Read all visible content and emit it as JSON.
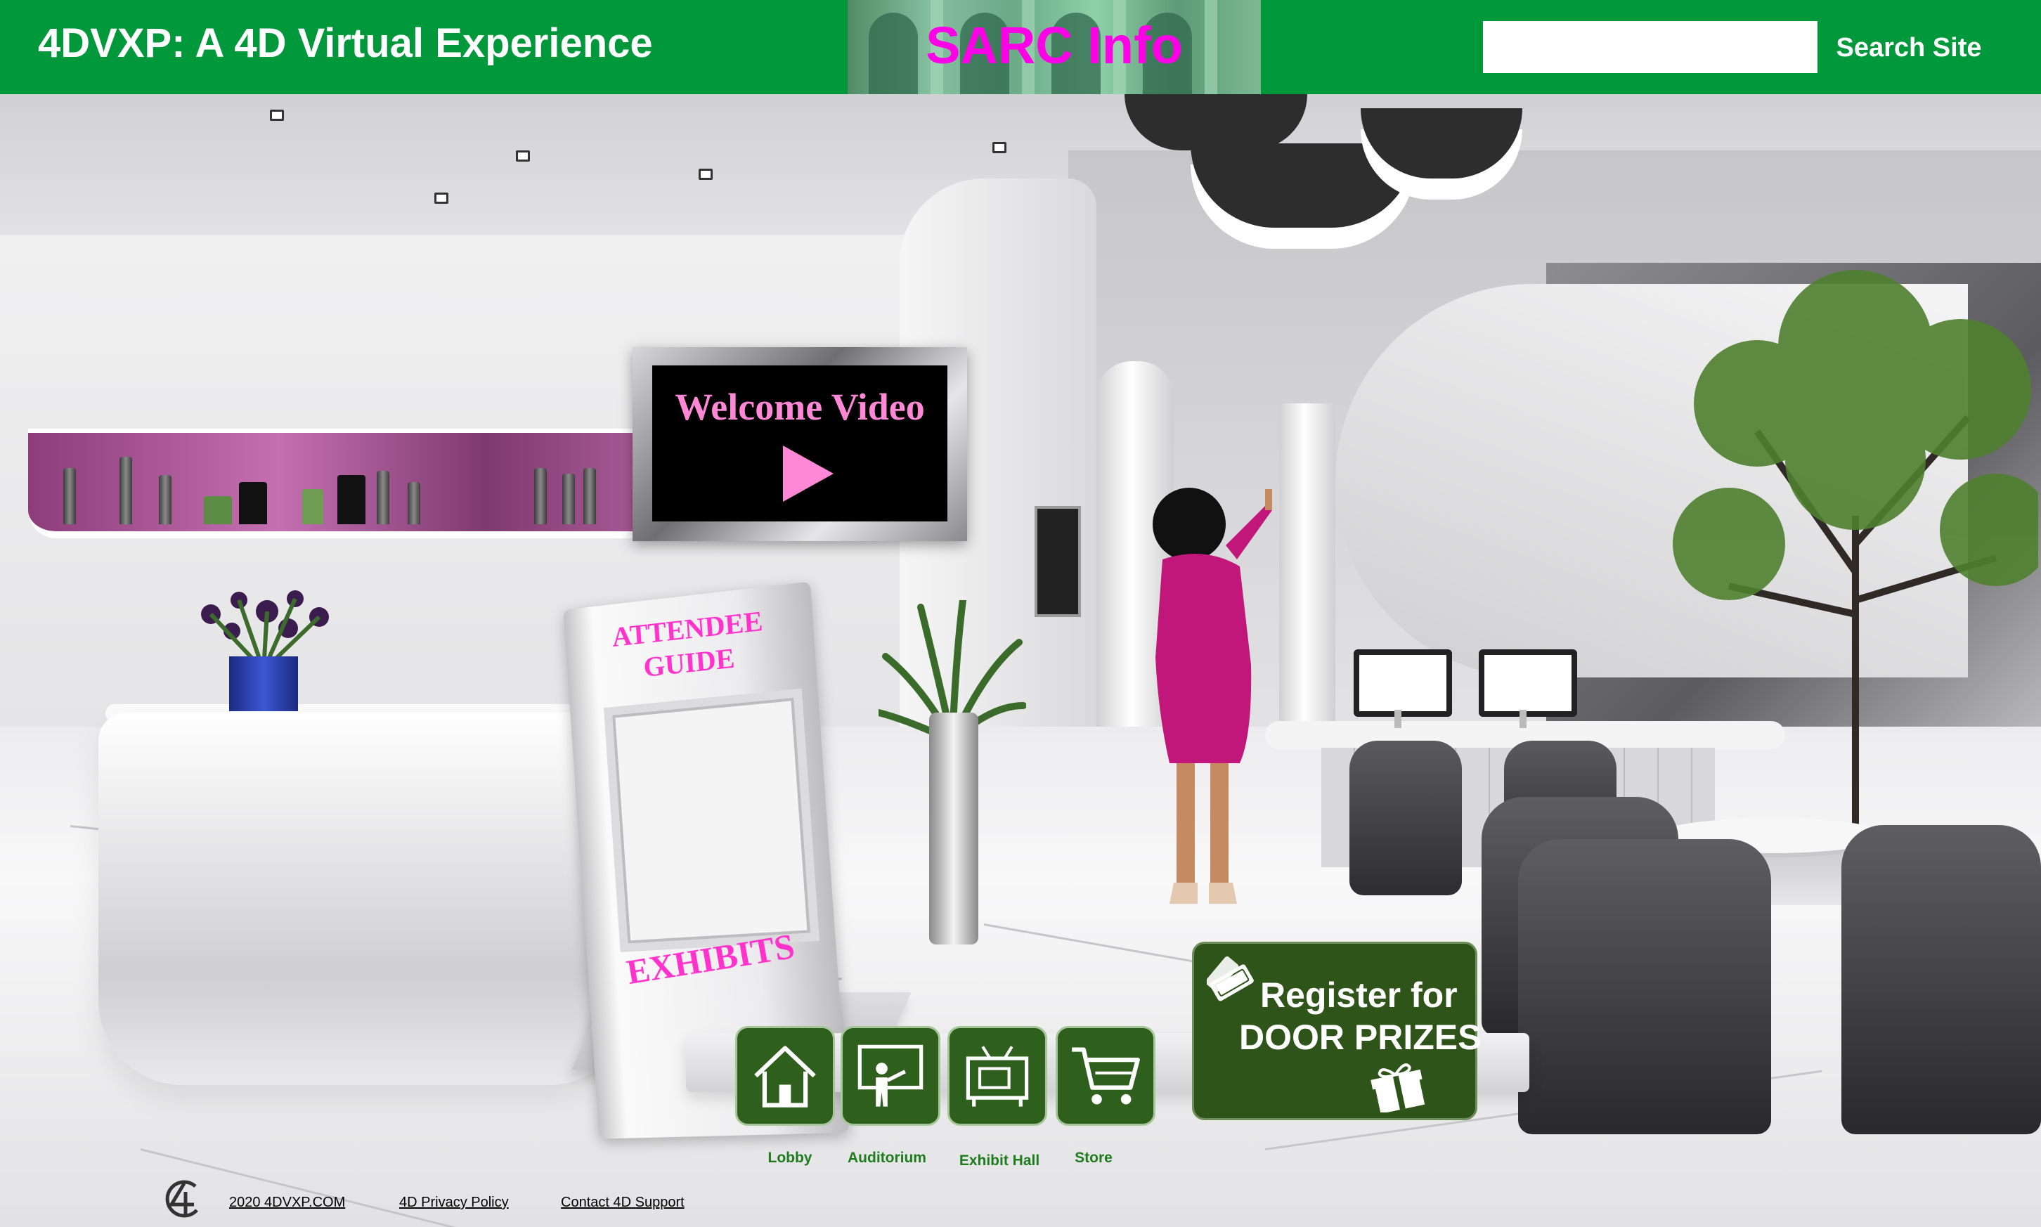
{
  "header": {
    "site_title": "4DVXP:  A 4D Virtual Experience",
    "banner_text": "SARC Info",
    "search": {
      "value": "",
      "placeholder": "",
      "button_label": "Search Site"
    }
  },
  "scene": {
    "welcome_video": {
      "title": "Welcome Video",
      "icon": "play-icon"
    },
    "attendee_guide": {
      "title": "ATTENDEE\nGUIDE",
      "exhibits": "EXHIBITS"
    }
  },
  "nav": {
    "items": [
      {
        "label": "Lobby",
        "icon": "home-icon"
      },
      {
        "label": "Auditorium",
        "icon": "presenter-icon"
      },
      {
        "label": "Exhibit Hall",
        "icon": "exhibit-booth-icon"
      },
      {
        "label": "Store",
        "icon": "shopping-cart-icon"
      }
    ]
  },
  "door_prizes": {
    "line1": "Register for",
    "line2": "DOOR PRIZES",
    "icons": [
      "ticket-icon",
      "gift-icon"
    ]
  },
  "footer": {
    "copyright": "2020 4DVXP.COM",
    "privacy": "4D Privacy Policy",
    "support": "Contact 4D Support"
  },
  "colors": {
    "header_green": "#00983a",
    "nav_button_green": "#2f5f1c",
    "nav_label_green": "#1e7b1e",
    "banner_magenta": "#ff00e6",
    "accent_pink": "#ff33cc",
    "video_pink": "#ff88d6"
  }
}
